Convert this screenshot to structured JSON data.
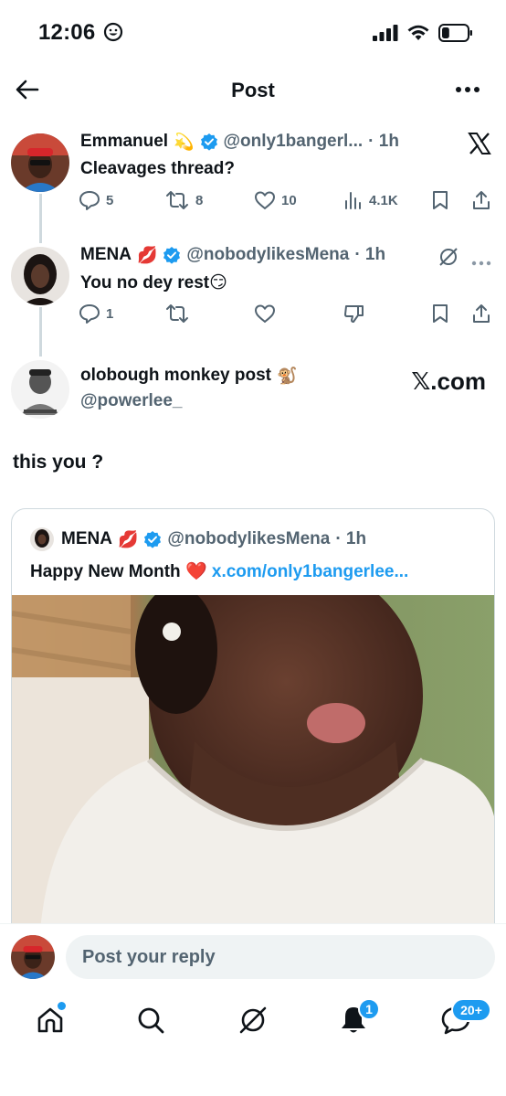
{
  "status_bar": {
    "time": "12:06",
    "time_icon": "smiley-face-icon",
    "battery_level": 0.3
  },
  "header": {
    "title": "Post"
  },
  "thread": [
    {
      "name": "Emmanuel",
      "name_emoji": "💫",
      "verified": true,
      "handle": "@only1bangerl...",
      "time": "· 1h",
      "text": "Cleavages thread?",
      "counts": {
        "replies": "5",
        "reposts": "8",
        "likes": "10",
        "views": "4.1K"
      }
    },
    {
      "name": "MENA",
      "name_emoji": "💋",
      "verified": true,
      "handle": "@nobodylikesMena",
      "time": "· 1h",
      "text": "You no dey rest😏",
      "counts": {
        "replies": "1"
      }
    },
    {
      "name": "olobough monkey post",
      "name_emoji": "🐒",
      "handle": "@powerlee_",
      "watermark": "𝕏.com"
    }
  ],
  "main_text": "this you ?",
  "quote": {
    "name": "MENA",
    "name_emoji": "💋",
    "verified": true,
    "handle": "@nobodylikesMena",
    "time": "· 1h",
    "text": "Happy New Month ❤️ ",
    "link": "x.com/only1bangerlee..."
  },
  "reply": {
    "placeholder": "Post your reply"
  },
  "nav": {
    "notifications_badge": "1",
    "messages_badge": "20+"
  },
  "colors": {
    "accent": "#1d9bf0",
    "text": "#0f1419",
    "secondary": "#536471",
    "border": "#cfd9de"
  }
}
